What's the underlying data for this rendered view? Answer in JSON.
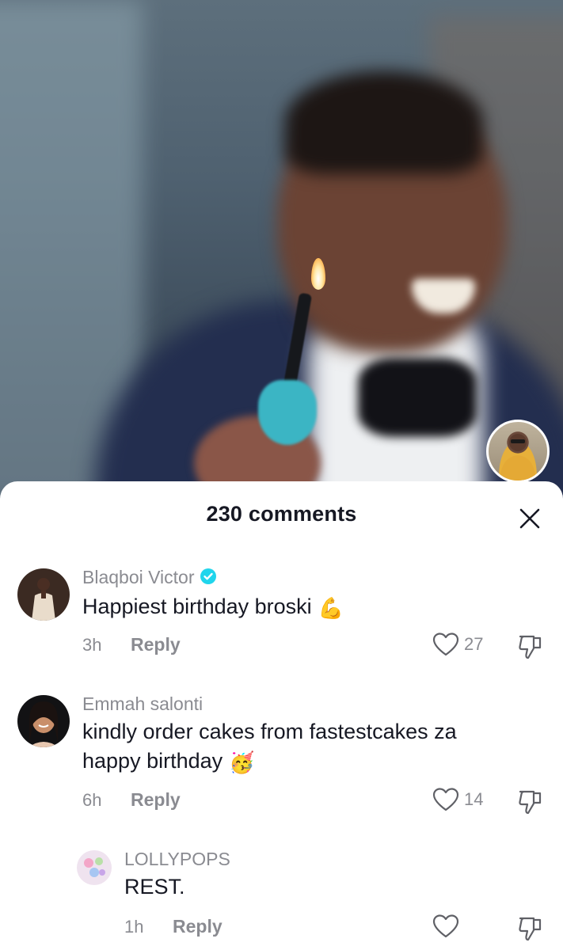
{
  "sheet": {
    "title": "230 comments"
  },
  "comments": [
    {
      "username": "Blaqboi Victor",
      "verified": true,
      "text": "Happiest birthday broski",
      "emoji": "💪",
      "time": "3h",
      "reply_label": "Reply",
      "likes": "27"
    },
    {
      "username": "Emmah salonti",
      "verified": false,
      "text_line1": "kindly order cakes from fastestcakes za",
      "text_line2": "happy birthday",
      "emoji": "🥳",
      "time": "6h",
      "reply_label": "Reply",
      "likes": "14"
    },
    {
      "username": "LOLLYPOPS",
      "verified": false,
      "text": "REST.",
      "time": "1h",
      "reply_label": "Reply",
      "likes": ""
    }
  ],
  "colors": {
    "verified_badge": "#20d5ec",
    "secondary_text": "#8a8b91",
    "primary_text": "#161823"
  },
  "icons": {
    "close": "close-icon",
    "like": "heart-outline-icon",
    "dislike": "thumbs-down-outline-icon",
    "verified": "verified-check-icon"
  }
}
